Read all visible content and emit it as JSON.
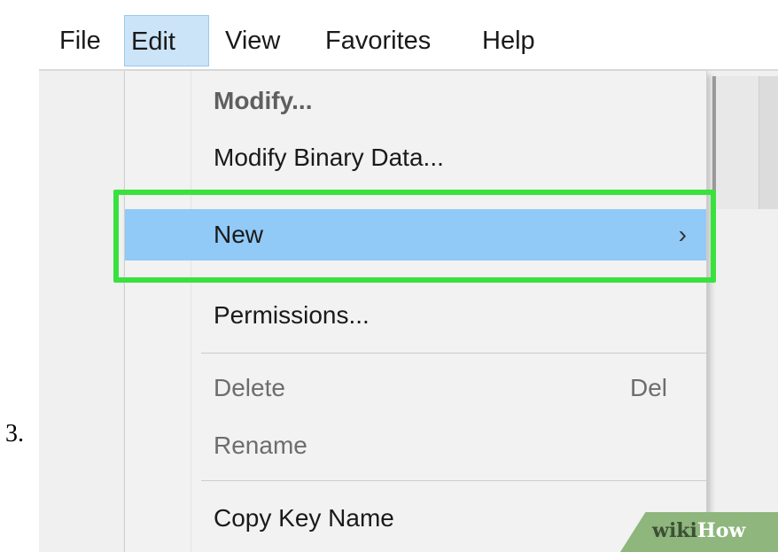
{
  "step_number": "3.",
  "menubar": {
    "items": [
      {
        "label": "File"
      },
      {
        "label": "Edit",
        "active": true
      },
      {
        "label": "View"
      },
      {
        "label": "Favorites"
      },
      {
        "label": "Help"
      }
    ]
  },
  "edit_menu": {
    "items": [
      {
        "label": "Modify...",
        "bold": true
      },
      {
        "label": "Modify Binary Data..."
      },
      {
        "label": "New",
        "highlighted": true,
        "submenu_icon": "chevron-right-icon"
      },
      {
        "label": "Permissions..."
      },
      {
        "label": "Delete",
        "shortcut": "Del",
        "disabled": true
      },
      {
        "label": "Rename",
        "disabled": true
      },
      {
        "label": "Copy Key Name"
      }
    ]
  },
  "submenu_chevron": "›",
  "watermark": {
    "wiki": "wiki",
    "how": "How"
  },
  "colors": {
    "highlight": "#91c9f7",
    "callout_box": "#39e13d",
    "menu_active": "#cce4f7"
  }
}
